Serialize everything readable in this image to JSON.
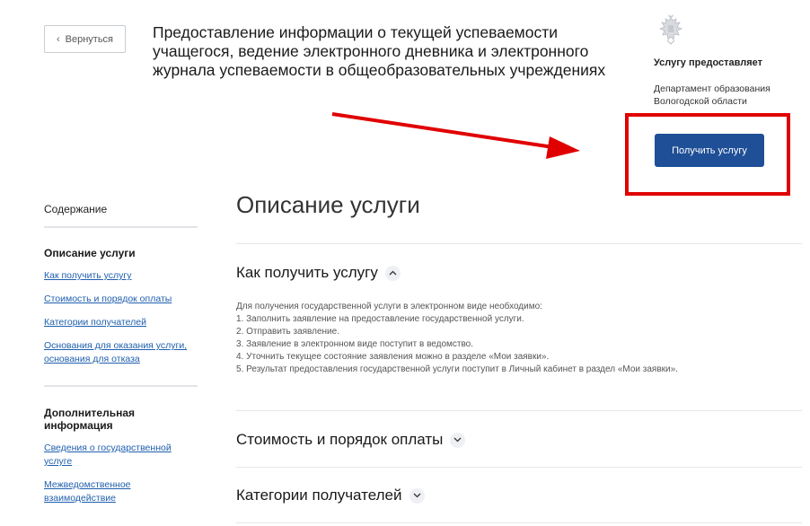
{
  "header": {
    "back_label": "Вернуться",
    "service_title": "Предоставление информации о текущей успеваемости\nучащегося, ведение электронного дневника и электронного\nжурнала успеваемости в общеобразовательных учреждениях"
  },
  "provider": {
    "emblem_icon": "russia-coat-of-arms-icon",
    "label": "Услугу предоставляет",
    "name": "Департамент образования\nВологодской области",
    "get_service_label": "Получить услугу"
  },
  "colors": {
    "primary_button": "#1f4f96",
    "annotation_red": "#e00000",
    "link": "#1f5fae"
  },
  "sidebar": {
    "contents_title": "Содержание",
    "sections": [
      {
        "title": "Описание услуги",
        "links": [
          "Как получить услугу",
          "Стоимость и порядок оплаты",
          "Категории получателей",
          "Основания для оказания услуги,\nоснования для отказа"
        ]
      },
      {
        "title": "Дополнительная информация",
        "links": [
          "Сведения о государственной\nуслуге",
          "Межведомственное\nвзаимодействие"
        ]
      }
    ]
  },
  "main": {
    "heading": "Описание услуги",
    "how_to": {
      "title": "Как получить услугу",
      "intro": "Для получения государственной услуги в электронном виде необходимо:",
      "steps": [
        "1. Заполнить заявление на предоставление государственной услуги.",
        "2. Отправить заявление.",
        "3. Заявление в электронном виде поступит в ведомство.",
        "4. Уточнить текущее состояние заявления можно в разделе «Мои заявки».",
        "5. Результат предоставления государственной услуги поступит в Личный кабинет в раздел «Мои заявки»."
      ]
    },
    "cost": {
      "title": "Стоимость и порядок оплаты"
    },
    "recipients": {
      "title": "Категории получателей"
    }
  }
}
